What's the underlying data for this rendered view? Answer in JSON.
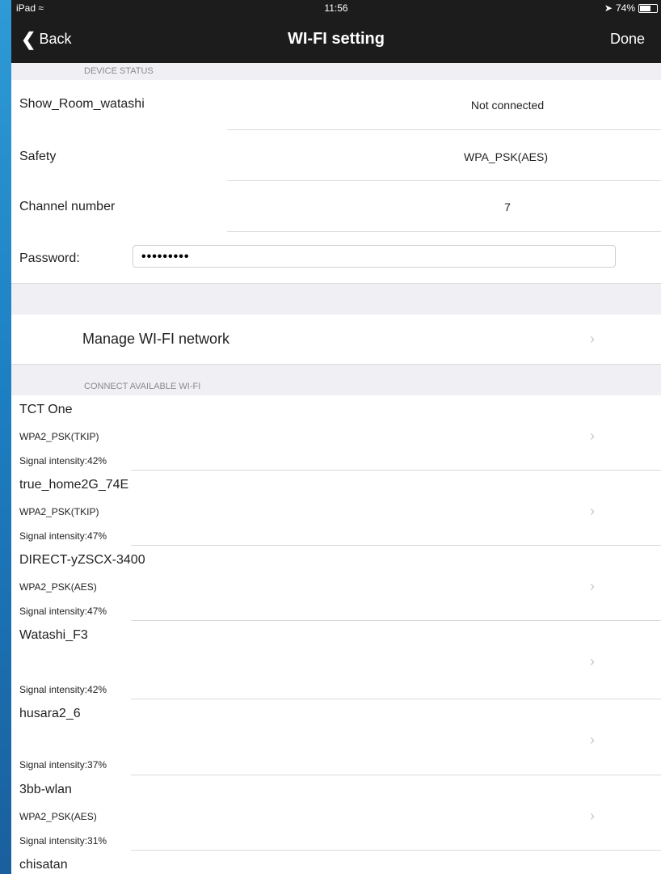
{
  "status_bar": {
    "device": "iPad",
    "wifi_icon": "wifi-icon",
    "time": "11:56",
    "battery": "74%",
    "battery_level": 0.74
  },
  "nav": {
    "back_label": "Back",
    "title": "WI-FI setting",
    "done_label": "Done"
  },
  "device_status": {
    "header": "DEVICE STATUS",
    "ssid_label": "Show_Room_watashi",
    "ssid_value": "Not connected",
    "safety_label": "Safety",
    "safety_value": "WPA_PSK(AES)",
    "channel_label": "Channel number",
    "channel_value": "7",
    "password_label": "Password:",
    "password_value": "•••••••••"
  },
  "manage": {
    "label": "Manage WI-FI network"
  },
  "available": {
    "header": "CONNECT AVAILABLE WI-FI",
    "networks": [
      {
        "name": "TCT One",
        "security": "WPA2_PSK(TKIP)",
        "signal": "Signal intensity:42%"
      },
      {
        "name": "true_home2G_74E",
        "security": "WPA2_PSK(TKIP)",
        "signal": "Signal intensity:47%"
      },
      {
        "name": "DIRECT-yZSCX-3400",
        "security": "WPA2_PSK(AES)",
        "signal": "Signal intensity:47%"
      },
      {
        "name": "Watashi_F3",
        "security": "",
        "signal": "Signal intensity:42%"
      },
      {
        "name": "husara2_6",
        "security": "",
        "signal": "Signal intensity:37%"
      },
      {
        "name": "3bb-wlan",
        "security": "WPA2_PSK(AES)",
        "signal": "Signal intensity:31%"
      },
      {
        "name": "chisatan",
        "security": "",
        "signal": ""
      }
    ]
  }
}
